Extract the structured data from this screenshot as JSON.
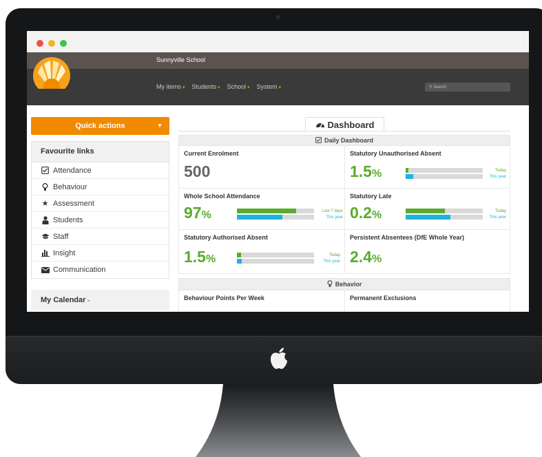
{
  "window": {
    "school_name": "Sunnyville School"
  },
  "nav": {
    "items": [
      {
        "label": "My items"
      },
      {
        "label": "Students"
      },
      {
        "label": "School"
      },
      {
        "label": "System"
      }
    ],
    "caret": "▾",
    "search_placeholder": "Search"
  },
  "sidebar": {
    "quick_actions": "Quick actions",
    "quick_actions_arrow": "▼",
    "favourites_title": "Favourite links",
    "links": [
      {
        "label": "Attendance",
        "icon": "checkbox-icon"
      },
      {
        "label": "Behaviour",
        "icon": "lightbulb-icon"
      },
      {
        "label": "Assessment",
        "icon": "star-icon"
      },
      {
        "label": "Students",
        "icon": "user-icon"
      },
      {
        "label": "Staff",
        "icon": "graduation-cap-icon"
      },
      {
        "label": "Insight",
        "icon": "bar-chart-icon"
      },
      {
        "label": "Communication",
        "icon": "envelope-icon"
      }
    ],
    "calendar_title": "My Calendar",
    "calendar_arrow": "▸"
  },
  "dashboard": {
    "tab_label": "Dashboard",
    "daily_header": "Daily Dashboard",
    "behavior_header": "Behavior",
    "cards": [
      {
        "title": "Current Enrolment",
        "value": "500",
        "unit": ""
      },
      {
        "title": "Statutory Unauthorised Absent",
        "value": "1.5",
        "unit": "%",
        "bars": [
          {
            "label": "Today",
            "fill": 0.04
          },
          {
            "label": "This year",
            "fill": 0.1
          }
        ]
      },
      {
        "title": "Whole School Attendance",
        "value": "97",
        "unit": "%",
        "bars": [
          {
            "label": "Last 7 days",
            "fill": 0.77
          },
          {
            "label": "This year",
            "fill": 0.59
          }
        ]
      },
      {
        "title": "Statutory Late",
        "value": "0.2",
        "unit": "%",
        "bars": [
          {
            "label": "Today",
            "fill": 0.51
          },
          {
            "label": "This year",
            "fill": 0.58
          }
        ]
      },
      {
        "title": "Statutory Authorised Absent",
        "value": "1.5",
        "unit": "%",
        "bars": [
          {
            "label": "Today",
            "fill": 0.05
          },
          {
            "label": "This year",
            "fill": 0.06
          }
        ]
      },
      {
        "title": "Persistent Absentees (DfE Whole Year)",
        "value": "2.4",
        "unit": "%"
      },
      {
        "title": "Behaviour Points Per Week"
      },
      {
        "title": "Permanent Exclusions"
      }
    ]
  },
  "colors": {
    "accent": "#f18a00",
    "green": "#5aab2e",
    "blue": "#1fb4dd",
    "header": "#3a3a3a",
    "school_bar": "#5b5350"
  }
}
